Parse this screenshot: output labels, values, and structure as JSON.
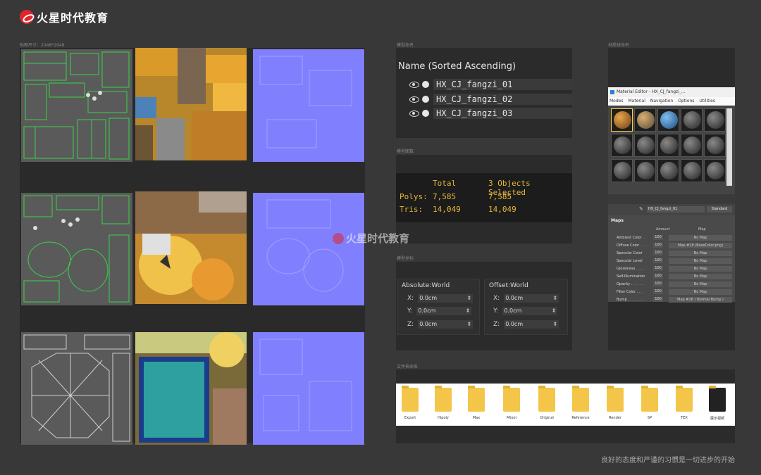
{
  "brand": {
    "name": "火星时代教育"
  },
  "sections": {
    "uv_label": "贴图尺寸：2048*2048",
    "naming_label": "模型命名",
    "faces_label": "模型面数",
    "coords_label": "模型坐标",
    "material_label": "材质球命名",
    "folders_label": "文件夹命名"
  },
  "scene": {
    "header": "Name (Sorted Ascending)",
    "objects": [
      "HX_CJ_fangzi_01",
      "HX_CJ_fangzi_02",
      "HX_CJ_fangzi_03"
    ]
  },
  "stats": {
    "total_label": "Total",
    "selected_label": "3 Objects Selected",
    "polys_label": "Polys:",
    "tris_label": "Tris:",
    "polys_total": "7,585",
    "polys_selected": "7,585",
    "tris_total": "14,049",
    "tris_selected": "14,049"
  },
  "coords": {
    "absolute_label": "Absolute:World",
    "offset_label": "Offset:World",
    "x_label": "X:",
    "y_label": "Y:",
    "z_label": "Z:",
    "value": "0.0cm"
  },
  "material_editor": {
    "title": "Material Editor - HX_CJ_fangzi_...",
    "menu": [
      "Modes",
      "Material",
      "Navigation",
      "Options",
      "Utilities"
    ],
    "material_name": "HX_CJ_fangzi_01",
    "shader": "Standard",
    "maps_header": "Maps",
    "amount_col": "Amount",
    "map_col": "Map",
    "maps": [
      {
        "name": "Ambient Color . .",
        "amount": "100",
        "map": "No Map"
      },
      {
        "name": "Diffuse Color . . .",
        "amount": "100",
        "map": "Map #28 (BaseColor.png)"
      },
      {
        "name": "Specular Color",
        "amount": "100",
        "map": "No Map"
      },
      {
        "name": "Specular Level",
        "amount": "100",
        "map": "No Map"
      },
      {
        "name": "Glossiness . . . .",
        "amount": "100",
        "map": "No Map"
      },
      {
        "name": "Self-Illumination",
        "amount": "100",
        "map": "No Map"
      },
      {
        "name": "Opacity . . . . . .",
        "amount": "100",
        "map": "No Map"
      },
      {
        "name": "Filter Color . . .",
        "amount": "100",
        "map": "No Map"
      },
      {
        "name": "Bump . . . . . . .",
        "amount": "100",
        "map": "Map #26 ( Normal Bump )"
      }
    ]
  },
  "folders": [
    "Export",
    "Hipoly",
    "Max",
    "Mtool",
    "Original",
    "Reference",
    "Render",
    "SP",
    "TEX",
    "展示视频"
  ],
  "footer": "良好的态度和严谨的习惯是一切进步的开始",
  "colors": {
    "stats_text": "#e8b83a",
    "normal_map": "#8080ff",
    "uv_wire": "#39d24a",
    "brand_red": "#e0262b"
  }
}
